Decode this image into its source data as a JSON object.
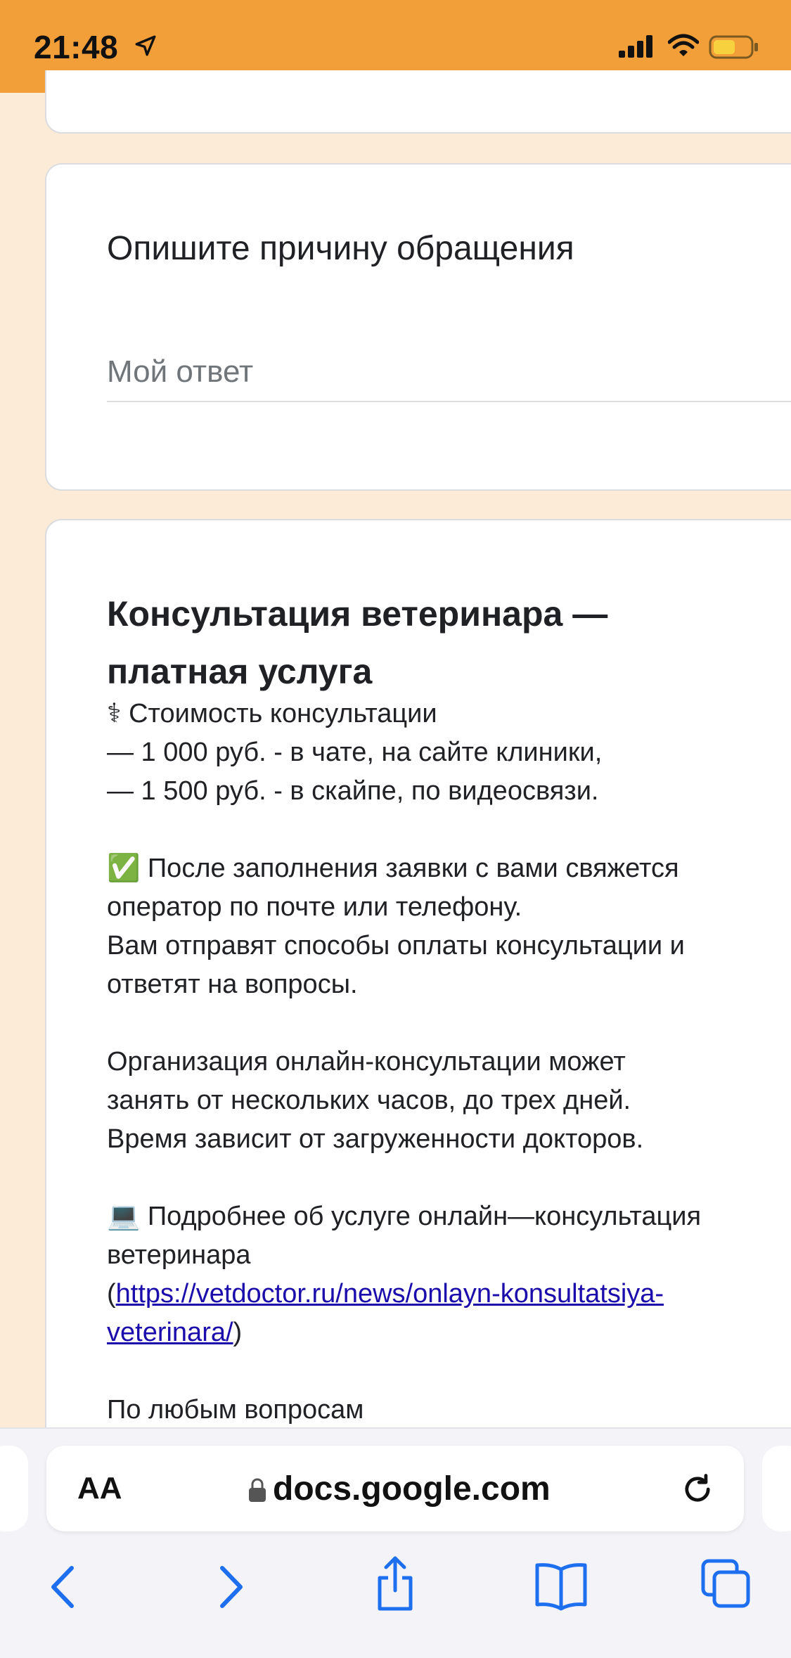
{
  "status_bar": {
    "time": "21:48"
  },
  "question": {
    "title": "Опишите причину обращения",
    "placeholder": "Мой ответ"
  },
  "info": {
    "title": "Консультация ветеринара — платная услуга",
    "lines": [
      "⚕  Стоимость консультации",
      "— 1 000 руб. - в чате, на сайте клиники,",
      "— 1 500 руб. - в скайпе, по видеосвязи.",
      "",
      "✅ После заполнения заявки с вами свяжется",
      "оператор по почте или телефону.",
      "Вам отправят способы оплаты консультации и",
      "ответят на вопросы.",
      "",
      "Организация онлайн-консультации может",
      "занять от нескольких часов, до трех дней.",
      "Время зависит от загруженности докторов.",
      "",
      "💻 Подробнее об услуге онлайн—консультация",
      "ветеринара"
    ],
    "link_prefix": "(",
    "link_line1": "https://vetdoctor.ru/news/onlayn-konsultatsiya-",
    "link_line2": "veterinara/",
    "link_suffix": ")",
    "last_line": "По любым вопросам"
  },
  "browser": {
    "text_size_label": "AA",
    "domain": "docs.google.com",
    "accent": "#1e6ff0"
  },
  "toolbar_icons": [
    "back-icon",
    "forward-icon",
    "share-icon",
    "bookmarks-icon",
    "tabs-icon"
  ]
}
